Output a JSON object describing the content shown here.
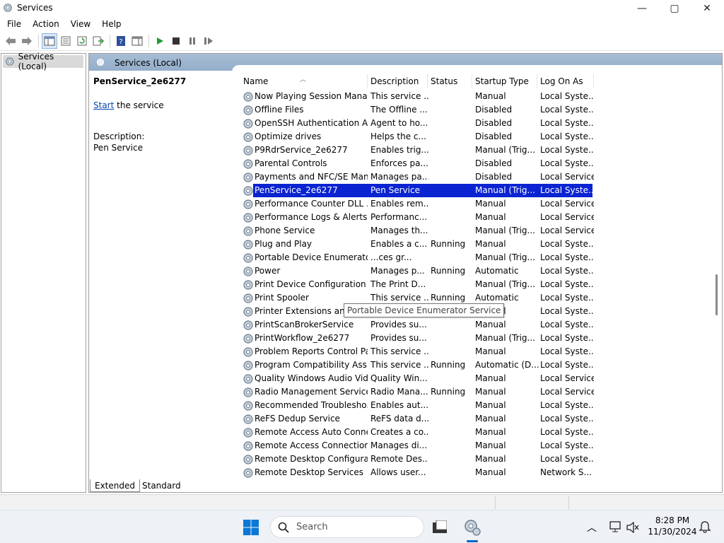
{
  "window": {
    "title": "Services",
    "minimize": "—",
    "maximize": "▢",
    "close": "✕"
  },
  "menu": [
    "File",
    "Action",
    "View",
    "Help"
  ],
  "tree": {
    "root_label": "Services (Local)"
  },
  "panel": {
    "header": "Services (Local)",
    "selected_name": "PenService_2e6277",
    "start_link": "Start",
    "start_suffix": " the service",
    "description_label": "Description:",
    "description_value": "Pen Service"
  },
  "columns": {
    "name": "Name",
    "description": "Description",
    "status": "Status",
    "startup": "Startup Type",
    "logon": "Log On As"
  },
  "rows": [
    {
      "name": "Now Playing Session Mana...",
      "desc": "This service ...",
      "status": "",
      "startup": "Manual",
      "logon": "Local Syste..."
    },
    {
      "name": "Offline Files",
      "desc": "The Offline ...",
      "status": "",
      "startup": "Disabled",
      "logon": "Local Syste..."
    },
    {
      "name": "OpenSSH Authentication A...",
      "desc": "Agent to ho...",
      "status": "",
      "startup": "Disabled",
      "logon": "Local Syste..."
    },
    {
      "name": "Optimize drives",
      "desc": "Helps the c...",
      "status": "",
      "startup": "Disabled",
      "logon": "Local Syste..."
    },
    {
      "name": "P9RdrService_2e6277",
      "desc": "Enables trig...",
      "status": "",
      "startup": "Manual (Trig...",
      "logon": "Local Syste..."
    },
    {
      "name": "Parental Controls",
      "desc": "Enforces pa...",
      "status": "",
      "startup": "Disabled",
      "logon": "Local Syste..."
    },
    {
      "name": "Payments and NFC/SE Man...",
      "desc": "Manages pa...",
      "status": "",
      "startup": "Disabled",
      "logon": "Local Service"
    },
    {
      "name": "PenService_2e6277",
      "desc": "Pen Service",
      "status": "",
      "startup": "Manual (Trig...",
      "logon": "Local Syste...",
      "selected": true
    },
    {
      "name": "Performance Counter DLL ...",
      "desc": "Enables rem...",
      "status": "",
      "startup": "Manual",
      "logon": "Local Service"
    },
    {
      "name": "Performance Logs & Alerts",
      "desc": "Performanc...",
      "status": "",
      "startup": "Manual",
      "logon": "Local Service"
    },
    {
      "name": "Phone Service",
      "desc": "Manages th...",
      "status": "",
      "startup": "Manual (Trig...",
      "logon": "Local Service"
    },
    {
      "name": "Plug and Play",
      "desc": "Enables a c...",
      "status": "Running",
      "startup": "Manual",
      "logon": "Local Syste..."
    },
    {
      "name": "Portable Device Enumerator Service",
      "desc": "...ces gr...",
      "status": "",
      "startup": "Manual (Trig...",
      "logon": "Local Syste..."
    },
    {
      "name": "Power",
      "desc": "Manages p...",
      "status": "Running",
      "startup": "Automatic",
      "logon": "Local Syste..."
    },
    {
      "name": "Print Device Configuration ...",
      "desc": "The Print D...",
      "status": "",
      "startup": "Manual (Trig...",
      "logon": "Local Syste..."
    },
    {
      "name": "Print Spooler",
      "desc": "This service ...",
      "status": "Running",
      "startup": "Automatic",
      "logon": "Local Syste..."
    },
    {
      "name": "Printer Extensions and Notif...",
      "desc": "This service ...",
      "status": "",
      "startup": "Manual",
      "logon": "Local Syste..."
    },
    {
      "name": "PrintScanBrokerService",
      "desc": "Provides su...",
      "status": "",
      "startup": "Manual",
      "logon": "Local Syste..."
    },
    {
      "name": "PrintWorkflow_2e6277",
      "desc": "Provides su...",
      "status": "",
      "startup": "Manual (Trig...",
      "logon": "Local Syste..."
    },
    {
      "name": "Problem Reports Control Pa...",
      "desc": "This service ...",
      "status": "",
      "startup": "Manual",
      "logon": "Local Syste..."
    },
    {
      "name": "Program Compatibility Assi...",
      "desc": "This service ...",
      "status": "Running",
      "startup": "Automatic (D...",
      "logon": "Local Syste..."
    },
    {
      "name": "Quality Windows Audio Vid...",
      "desc": "Quality Win...",
      "status": "",
      "startup": "Manual",
      "logon": "Local Service"
    },
    {
      "name": "Radio Management Service",
      "desc": "Radio Mana...",
      "status": "Running",
      "startup": "Manual",
      "logon": "Local Service"
    },
    {
      "name": "Recommended Troublesho...",
      "desc": "Enables aut...",
      "status": "",
      "startup": "Manual",
      "logon": "Local Syste..."
    },
    {
      "name": "ReFS Dedup Service",
      "desc": "ReFS data d...",
      "status": "",
      "startup": "Manual",
      "logon": "Local Syste..."
    },
    {
      "name": "Remote Access Auto Conne...",
      "desc": "Creates a co...",
      "status": "",
      "startup": "Manual",
      "logon": "Local Syste..."
    },
    {
      "name": "Remote Access Connection...",
      "desc": "Manages di...",
      "status": "",
      "startup": "Manual",
      "logon": "Local Syste..."
    },
    {
      "name": "Remote Desktop Configurat...",
      "desc": "Remote Des...",
      "status": "",
      "startup": "Manual",
      "logon": "Local Syste..."
    },
    {
      "name": "Remote Desktop Services",
      "desc": "Allows user...",
      "status": "",
      "startup": "Manual",
      "logon": "Network S..."
    }
  ],
  "tooltip": "Portable Device Enumerator Service",
  "tabs": {
    "extended": "Extended",
    "standard": "Standard"
  },
  "taskbar": {
    "search_placeholder": "Search",
    "time": "8:28 PM",
    "date": "11/30/2024"
  },
  "colors": {
    "selection": "#0a24d1",
    "link": "#0645ad",
    "header_blue": "#93adc9"
  }
}
